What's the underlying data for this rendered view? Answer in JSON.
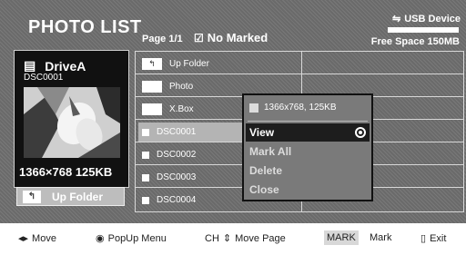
{
  "header": {
    "title": "PHOTO LIST",
    "page": "Page 1/1",
    "marked_status": "No Marked",
    "usb_device": "USB Device",
    "free_space": "Free Space 150MB"
  },
  "drive_panel": {
    "drive_name": "DriveA",
    "file_name": "DSC0001",
    "thumb_info": "1366×768  125KB",
    "up_folder_label": "Up Folder"
  },
  "file_list": {
    "items": [
      {
        "label": "Up Folder",
        "kind": "up-folder",
        "icon": "up-folder-icon"
      },
      {
        "label": "Photo",
        "kind": "folder",
        "icon": "folder-icon"
      },
      {
        "label": "X.Box",
        "kind": "folder",
        "icon": "folder-icon"
      },
      {
        "label": "DSC0001",
        "kind": "file",
        "icon": "photo-file-icon",
        "selected": true
      },
      {
        "label": "DSC0002",
        "kind": "file",
        "icon": "photo-file-icon"
      },
      {
        "label": "DSC0003",
        "kind": "file",
        "icon": "photo-file-icon"
      },
      {
        "label": "DSC0004",
        "kind": "file",
        "icon": "photo-file-icon"
      }
    ]
  },
  "popup_menu": {
    "info": "1366x768, 125KB",
    "items": [
      {
        "label": "View",
        "selected": true
      },
      {
        "label": "Mark All"
      },
      {
        "label": "Delete"
      },
      {
        "label": "Close"
      }
    ]
  },
  "footer": {
    "move": "Move",
    "popup_menu": "PopUp Menu",
    "ch": "CH",
    "move_page": "Move Page",
    "mark_key": "MARK",
    "mark": "Mark",
    "exit": "Exit"
  },
  "colors": {
    "background": "#6a6a6a",
    "panel": "#111111",
    "selected_row": "#b4b4b4",
    "popup_active": "#1d1d1d"
  }
}
